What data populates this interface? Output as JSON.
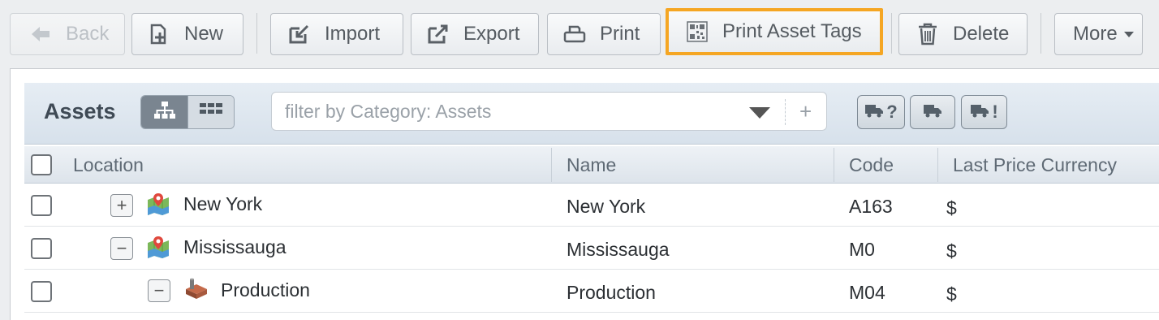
{
  "toolbar": {
    "back_label": "Back",
    "new_label": "New",
    "import_label": "Import",
    "export_label": "Export",
    "print_label": "Print",
    "print_tags_label": "Print Asset Tags",
    "delete_label": "Delete",
    "more_label": "More"
  },
  "panel": {
    "title": "Assets",
    "filter_placeholder": "filter by Category: Assets",
    "filter_add": "+",
    "truck_buttons": [
      "?",
      "",
      "!"
    ]
  },
  "table": {
    "columns": [
      "Location",
      "Name",
      "Code",
      "Last Price Currency"
    ],
    "rows": [
      {
        "location": "New York",
        "name": "New York",
        "code": "A163",
        "currency": "$",
        "expander": "+"
      },
      {
        "location": "Mississauga",
        "name": "Mississauga",
        "code": "M0",
        "currency": "$",
        "expander": "−"
      },
      {
        "location": "Production",
        "name": "Production",
        "code": "M04",
        "currency": "$",
        "expander": "−"
      }
    ]
  },
  "colors": {
    "highlight": "#f5a623",
    "header_bg": "#dde4eb",
    "toggle_active": "#7a8590"
  },
  "icons": {
    "back": "arrow-left-icon",
    "new": "new-document-icon",
    "import": "import-icon",
    "export": "export-icon",
    "print": "printer-icon",
    "print_tags": "qr-code-icon",
    "delete": "trash-icon",
    "more": "caret-down-icon"
  }
}
